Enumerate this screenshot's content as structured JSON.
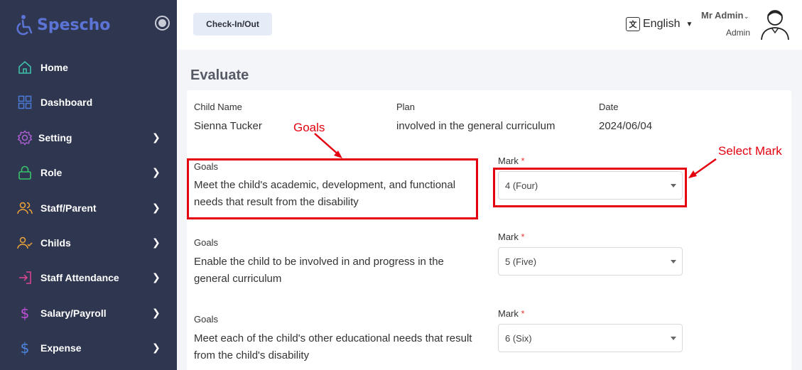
{
  "app": {
    "name": "Spescho"
  },
  "sidebar": {
    "items": [
      {
        "label": "Home",
        "icon": "home-icon",
        "has_submenu": false
      },
      {
        "label": "Dashboard",
        "icon": "grid-icon",
        "has_submenu": false
      },
      {
        "label": "Setting",
        "icon": "gear-icon",
        "has_submenu": true
      },
      {
        "label": "Role",
        "icon": "lock-icon",
        "has_submenu": true
      },
      {
        "label": "Staff/Parent",
        "icon": "users-icon",
        "has_submenu": true
      },
      {
        "label": "Childs",
        "icon": "user-check-icon",
        "has_submenu": true
      },
      {
        "label": "Staff Attendance",
        "icon": "login-icon",
        "has_submenu": true
      },
      {
        "label": "Salary/Payroll",
        "icon": "dollar-icon",
        "has_submenu": true
      },
      {
        "label": "Expense",
        "icon": "dollar-icon",
        "has_submenu": true
      }
    ]
  },
  "header": {
    "checkin_label": "Check-In/Out",
    "language": "English",
    "user_name": "Mr Admin",
    "user_role": "Admin"
  },
  "page": {
    "title": "Evaluate"
  },
  "evaluation": {
    "child_name_label": "Child Name",
    "child_name": "Sienna Tucker",
    "plan_label": "Plan",
    "plan": "involved in the general curriculum",
    "date_label": "Date",
    "date": "2024/06/04",
    "goals": [
      {
        "goal_label": "Goals",
        "text": "Meet the child's academic, development, and functional needs that result from the disability",
        "mark_label": "Mark",
        "mark_value": "4 (Four)"
      },
      {
        "goal_label": "Goals",
        "text": "Enable the child to be involved in and progress in the general curriculum",
        "mark_label": "Mark",
        "mark_value": "5 (Five)"
      },
      {
        "goal_label": "Goals",
        "text": "Meet each of the child's other educational needs that result from the child's disability",
        "mark_label": "Mark",
        "mark_value": "6 (Six)"
      }
    ],
    "required_mark": "*"
  },
  "annotations": {
    "goals_callout": "Goals",
    "select_mark_callout": "Select Mark"
  },
  "colors": {
    "sidebar_bg": "#2f3650",
    "accent": "#5b74d6",
    "annotation": "#e4000f"
  }
}
